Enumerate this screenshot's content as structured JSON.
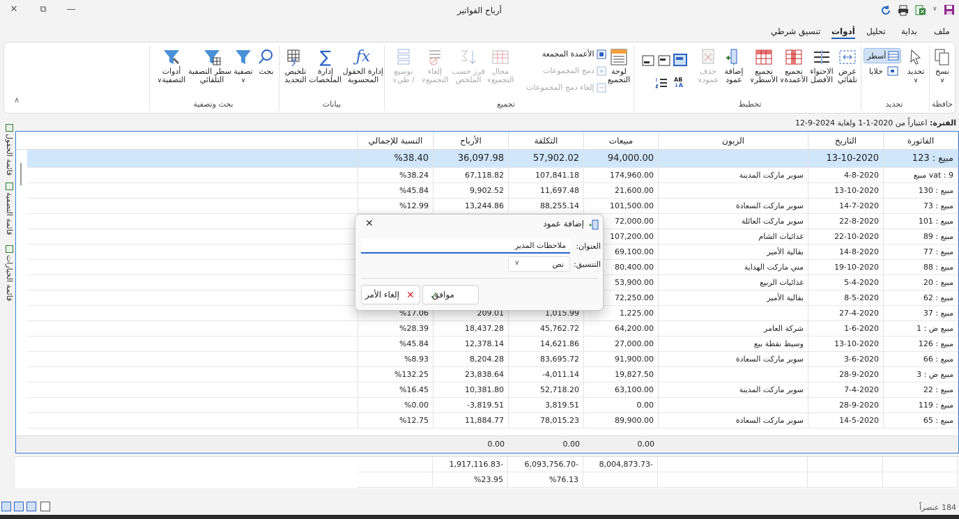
{
  "window": {
    "title": "أرباح الفواتير",
    "close": "✕",
    "restore": "⧉",
    "minimize": "—"
  },
  "menu": {
    "tabs": [
      "ملف",
      "بداية",
      "تحليل",
      "أدوات",
      "تنسيق شرطي"
    ],
    "active_index": 3
  },
  "ribbon": {
    "groups": {
      "clipboard": "حافظة",
      "select": "تحديد",
      "layout": "تخطيط",
      "grouping": "تجميع",
      "data": "بيانات",
      "search": "بحث وتصفية"
    },
    "copy": "نسخ",
    "select_btn": "تحديد",
    "rows": "أسطر",
    "cells": "خلايا",
    "autofit": [
      "عرض",
      "تلقائي"
    ],
    "best_fit": [
      "الاحتواء",
      "الأفضل"
    ],
    "group_cols": [
      "تجميع",
      "الأعمدة"
    ],
    "group_rows": [
      "تجميع",
      "الأسطر"
    ],
    "add_col": [
      "إضافة",
      "عمود"
    ],
    "del_col": [
      "حذف",
      "عمود"
    ],
    "panel": [
      "لوحة",
      "التجميع"
    ],
    "grouped_cols": "الأعمدة المجمعة",
    "merge_groups": "دمج المجموعات",
    "unmerge_groups": "إلغاء دمج المجموعات",
    "grouping_field": [
      "مجال",
      "التجميع"
    ],
    "sort_summary": [
      "فرز حسب",
      "الملخص"
    ],
    "cancel_group": [
      "إلغاء",
      "التجميع"
    ],
    "expand": [
      "توسيع",
      "/ طي"
    ],
    "calc_fields": [
      "إدارة الحقول",
      "المحسوبة"
    ],
    "manage_summaries": [
      "إدارة",
      "الملخصات"
    ],
    "summarize_sel": [
      "تلخيص",
      "التحديد"
    ],
    "search": "بحث",
    "filter": "تصفية",
    "auto_filter": [
      "سطر التصفية",
      "التلقائي"
    ],
    "filter_tools": [
      "أدوات",
      "التصفية"
    ]
  },
  "period": {
    "label": "الفترة:",
    "text": "اعتباراً من 2020-1-1 ولغاية 2024-9-12"
  },
  "columns": [
    "الفاتورة",
    "التاريخ",
    "الزبون",
    "مبيعات",
    "التكلفة",
    "الأرباح",
    "النسبة للإجمالي"
  ],
  "group_row": [
    "مبيع : 123",
    "13-10-2020",
    "",
    "94,000.00",
    "57,902.02",
    "36,097.98",
    "%38.40"
  ],
  "rows": [
    [
      "vat : 9 مبيع",
      "4-8-2020",
      "سوبر ماركت المدينة",
      "174,960.00",
      "107,841.18",
      "67,118.82",
      "%38.24"
    ],
    [
      "مبيع : 130",
      "13-10-2020",
      "",
      "21,600.00",
      "11,697.48",
      "9,902.52",
      "%45.84"
    ],
    [
      "مبيع : 73",
      "14-7-2020",
      "سوبر ماركت السعادة",
      "101,500.00",
      "88,255.14",
      "13,244.86",
      "%12.99"
    ],
    [
      "مبيع : 101",
      "22-8-2020",
      "سوبر ماركت العائلة",
      "72,000.00",
      "",
      "",
      ""
    ],
    [
      "مبيع : 89",
      "22-10-2020",
      "غذائيات الشام",
      "107,200.00",
      "",
      "",
      ""
    ],
    [
      "مبيع : 77",
      "14-8-2020",
      "بقالية الأمير",
      "69,100.00",
      "",
      "",
      ""
    ],
    [
      "مبيع : 88",
      "19-10-2020",
      "مني ماركت الهداية",
      "80,400.00",
      "",
      "",
      ""
    ],
    [
      "مبيع : 20",
      "5-4-2020",
      "غذائيات الربيع",
      "53,900.00",
      "",
      "",
      ""
    ],
    [
      "مبيع : 62",
      "8-5-2020",
      "بقالية الأمير",
      "72,250.00",
      "",
      "",
      ""
    ],
    [
      "مبيع : 37",
      "27-4-2020",
      "",
      "1,225.00",
      "1,015.99",
      "209.01",
      "%17.06"
    ],
    [
      "مبيع ض : 1",
      "1-6-2020",
      "شركة العامر",
      "64,200.00",
      "45,762.72",
      "18,437.28",
      "%28.39"
    ],
    [
      "مبيع : 126",
      "13-10-2020",
      "وسيط نقطة بيع",
      "27,000.00",
      "14,621.86",
      "12,378.14",
      "%45.84"
    ],
    [
      "مبيع : 66",
      "3-6-2020",
      "سوبر ماركت السعادة",
      "91,900.00",
      "83,695.72",
      "8,204.28",
      "%8.93"
    ],
    [
      "مبيع ض : 3",
      "28-9-2020",
      "",
      "19,827.50",
      "-4,011.14",
      "23,838.64",
      "%132.25"
    ],
    [
      "مبيع : 22",
      "7-4-2020",
      "سوبر ماركت المدينة",
      "63,100.00",
      "52,718.20",
      "10,381.80",
      "%16.45"
    ],
    [
      "مبيع : 119",
      "28-9-2020",
      "",
      "0.00",
      "3,819.51",
      "-3,819.51",
      "%0.00"
    ],
    [
      "مبيع : 65",
      "14-5-2020",
      "سوبر ماركت السعادة",
      "89,900.00",
      "78,015.23",
      "11,884.77",
      "%12.75"
    ]
  ],
  "group_footer": {
    "sales": "0.00",
    "cost": "0.00",
    "profit": "0.00"
  },
  "totals": {
    "sales": "8,004,873.73-",
    "cost": "6,093,756.70-",
    "profit": "1,917,116.83-",
    "cost_pct": "%76.13",
    "profit_pct": "%23.95"
  },
  "side_tabs": [
    "قائمة الحقول",
    "قائمة التصفية",
    "قائمة الخيارات"
  ],
  "dialog": {
    "title": "إضافة عمود",
    "title_label": "العنوان:",
    "title_value": "ملاحظات المدير",
    "format_label": "التنسيق:",
    "format_value": "نص",
    "ok": "موافق",
    "cancel": "إلغاء الأمر"
  },
  "status": {
    "count": "184 عنصراً"
  },
  "colors": {
    "accent": "#1a5fb4",
    "selected_row": "#cfe6fb",
    "dialog_accent": "#2b63c6"
  }
}
